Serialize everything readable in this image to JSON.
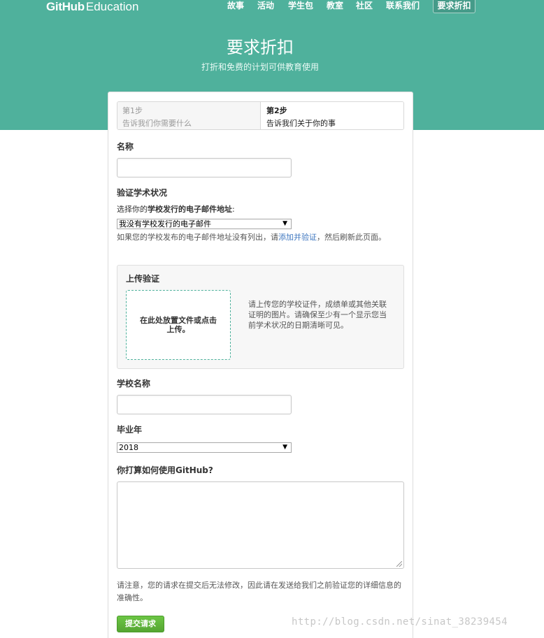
{
  "brand": {
    "bold": "GitHub",
    "light": "Education"
  },
  "nav": {
    "items": [
      "故事",
      "活动",
      "学生包",
      "教室",
      "社区",
      "联系我们"
    ],
    "active": "要求折扣"
  },
  "hero": {
    "title": "要求折扣",
    "subtitle": "打折和免费的计划可供教育使用"
  },
  "steps": [
    {
      "number": "第1步",
      "desc": "告诉我们你需要什么"
    },
    {
      "number": "第2步",
      "desc": "告诉我们关于你的事"
    }
  ],
  "form": {
    "name_label": "名称",
    "verify_label": "验证学术状况",
    "email_prompt_prefix": "选择你的",
    "email_prompt_bold": "学校发行的电子邮件地址",
    "email_prompt_suffix": ":",
    "email_select_value": "我没有学校发行的电子邮件",
    "hint_prefix": "如果您的学校发布的电子邮件地址没有列出，请",
    "hint_link": "添加并验证",
    "hint_suffix": "，然后刷新此页面。",
    "upload": {
      "title": "上传验证",
      "dropzone_text": "在此处放置文件或点击上传。",
      "help": "请上传您的学校证件，成绩单或其他关联证明的图片。请确保至少有一个显示您当前学术状况的日期清晰可见。"
    },
    "school_label": "学校名称",
    "grad_label": "毕业年",
    "grad_value": "2018",
    "usage_label": "你打算如何使用GitHub?",
    "notice": "请注意，您的请求在提交后无法修改，因此请在发送给我们之前验证您的详细信息的准确性。",
    "submit_label": "提交请求"
  },
  "watermark": "http://blog.csdn.net/sinat_38239454",
  "colors": {
    "hero_bg": "#4fb19c",
    "link": "#4078c0",
    "submit": "#6cc644"
  }
}
